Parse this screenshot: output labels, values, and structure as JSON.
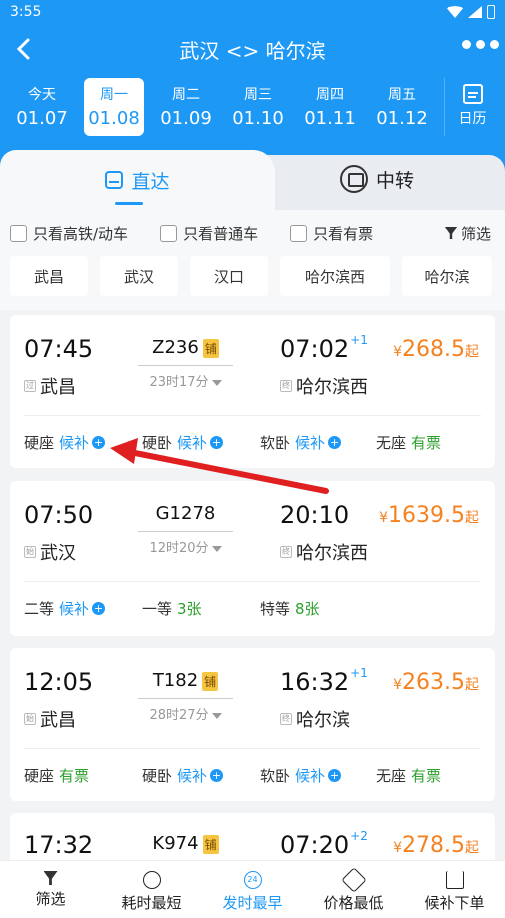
{
  "status": {
    "time": "3:55"
  },
  "header": {
    "title": "武汉 <> 哈尔滨"
  },
  "dates": [
    {
      "week": "今天",
      "date": "01.07",
      "active": false
    },
    {
      "week": "周一",
      "date": "01.08",
      "active": true
    },
    {
      "week": "周二",
      "date": "01.09",
      "active": false
    },
    {
      "week": "周三",
      "date": "01.10",
      "active": false
    },
    {
      "week": "周四",
      "date": "01.11",
      "active": false
    },
    {
      "week": "周五",
      "date": "01.12",
      "active": false
    }
  ],
  "calendar_label": "日历",
  "tabs": {
    "direct": "直达",
    "transfer": "中转"
  },
  "filters": {
    "high_speed": "只看高铁/动车",
    "normal": "只看普通车",
    "available": "只看有票",
    "filter": "筛选"
  },
  "stations": [
    "武昌",
    "武汉",
    "汉口",
    "哈尔滨西",
    "哈尔滨"
  ],
  "tag_labels": {
    "pass": "过",
    "origin": "始",
    "terminal": "终"
  },
  "trains": [
    {
      "dep": "07:45",
      "arr": "07:02",
      "plus": "+1",
      "code": "Z236",
      "badge": "铺",
      "duration": "23时17分",
      "price_cur": "¥",
      "price": "268.5",
      "price_suffix": "起",
      "from": "武昌",
      "from_tag": "过",
      "to": "哈尔滨西",
      "to_tag": "终",
      "seats": [
        {
          "type": "硬座",
          "status": "候补",
          "kind": "waitlist"
        },
        {
          "type": "硬卧",
          "status": "候补",
          "kind": "waitlist"
        },
        {
          "type": "软卧",
          "status": "候补",
          "kind": "waitlist"
        },
        {
          "type": "无座",
          "status": "有票",
          "kind": "available"
        }
      ]
    },
    {
      "dep": "07:50",
      "arr": "20:10",
      "plus": "",
      "code": "G1278",
      "badge": "",
      "duration": "12时20分",
      "price_cur": "¥",
      "price": "1639.5",
      "price_suffix": "起",
      "from": "武汉",
      "from_tag": "始",
      "to": "哈尔滨西",
      "to_tag": "终",
      "seats": [
        {
          "type": "二等",
          "status": "候补",
          "kind": "waitlist"
        },
        {
          "type": "一等",
          "status": "3张",
          "kind": "available"
        },
        {
          "type": "特等",
          "status": "8张",
          "kind": "available"
        }
      ]
    },
    {
      "dep": "12:05",
      "arr": "16:32",
      "plus": "+1",
      "code": "T182",
      "badge": "铺",
      "duration": "28时27分",
      "price_cur": "¥",
      "price": "263.5",
      "price_suffix": "起",
      "from": "武昌",
      "from_tag": "始",
      "to": "哈尔滨",
      "to_tag": "终",
      "seats": [
        {
          "type": "硬座",
          "status": "有票",
          "kind": "available"
        },
        {
          "type": "硬卧",
          "status": "候补",
          "kind": "waitlist"
        },
        {
          "type": "软卧",
          "status": "候补",
          "kind": "waitlist"
        },
        {
          "type": "无座",
          "status": "有票",
          "kind": "available"
        }
      ]
    },
    {
      "dep": "17:32",
      "arr": "07:20",
      "plus": "+2",
      "code": "K974",
      "badge": "铺",
      "duration": "",
      "price_cur": "¥",
      "price": "278.5",
      "price_suffix": "起",
      "from": "",
      "from_tag": "",
      "to": "",
      "to_tag": "",
      "seats": []
    }
  ],
  "bottom": [
    {
      "label": "筛选",
      "icon": "funnel-icon",
      "active": false
    },
    {
      "label": "耗时最短",
      "icon": "timer-icon",
      "active": false
    },
    {
      "label": "发时最早",
      "icon": "clock-24-icon",
      "active": true
    },
    {
      "label": "价格最低",
      "icon": "price-tag-icon",
      "active": false
    },
    {
      "label": "候补下单",
      "icon": "cart-icon",
      "active": false
    }
  ],
  "clock_icon_text": "24",
  "colors": {
    "primary": "#1e98f5",
    "price": "#f58220",
    "available": "#2ca02c",
    "annotation_arrow": "#e02020"
  }
}
